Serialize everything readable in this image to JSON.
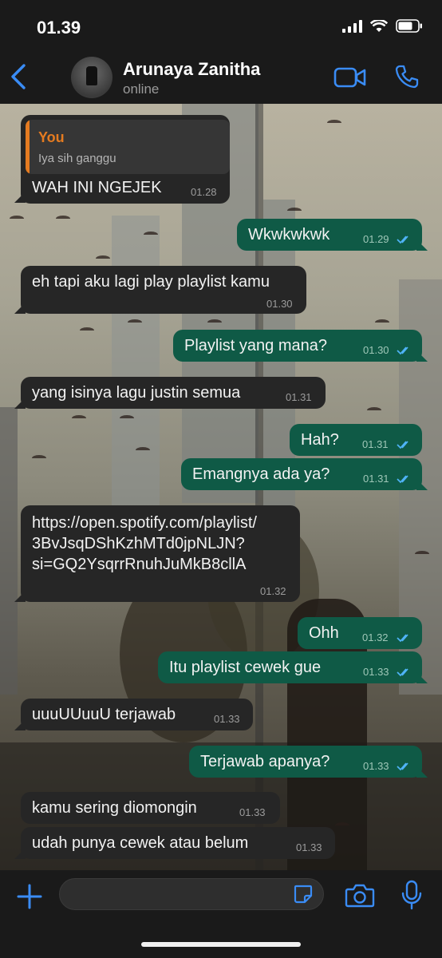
{
  "status_bar": {
    "time": "01.39"
  },
  "header": {
    "contact_name": "Arunaya Zanitha",
    "contact_status": "online"
  },
  "colors": {
    "accent": "#3a8cf5",
    "incoming_bubble": "#262626",
    "outgoing_bubble": "#0f5a46",
    "reply_accent": "#e57b20",
    "read_ticks": "#4fb3f6"
  },
  "icons": [
    "back-chevron-icon",
    "video-call-icon",
    "phone-icon",
    "plus-icon",
    "sticker-icon",
    "camera-icon",
    "microphone-icon",
    "double-check-icon"
  ],
  "messages": [
    {
      "direction": "in",
      "reply_sender": "You",
      "reply_text": "Iya sih ganggu",
      "text": "WAH INI NGEJEK",
      "time": "01.28"
    },
    {
      "direction": "out",
      "text": "Wkwkwkwk",
      "time": "01.29",
      "read": true
    },
    {
      "direction": "in",
      "text": "eh tapi aku lagi play playlist kamu",
      "time": "01.30"
    },
    {
      "direction": "out",
      "text": "Playlist yang mana?",
      "time": "01.30",
      "read": true
    },
    {
      "direction": "in",
      "text": "yang isinya lagu justin semua",
      "time": "01.31"
    },
    {
      "direction": "out",
      "text": "Hah?",
      "time": "01.31",
      "read": true
    },
    {
      "direction": "out",
      "text": "Emangnya ada ya?",
      "time": "01.31",
      "read": true
    },
    {
      "direction": "in",
      "lines": [
        "https://open.spotify.com/playlist/",
        "3BvJsqDShKzhMTd0jpNLJN?",
        "si=GQ2YsqrrRnuhJuMkB8cllA"
      ],
      "time": "01.32"
    },
    {
      "direction": "out",
      "text": "Ohh",
      "time": "01.32",
      "read": true
    },
    {
      "direction": "out",
      "text": "Itu playlist cewek gue",
      "time": "01.33",
      "read": true
    },
    {
      "direction": "in",
      "text": "uuuUUuuU terjawab",
      "time": "01.33"
    },
    {
      "direction": "out",
      "text": "Terjawab apanya?",
      "time": "01.33",
      "read": true
    },
    {
      "direction": "in",
      "text": "kamu sering diomongin",
      "time": "01.33"
    },
    {
      "direction": "in",
      "text": "udah punya cewek atau belum",
      "time": "01.33"
    }
  ],
  "input": {
    "placeholder": ""
  }
}
